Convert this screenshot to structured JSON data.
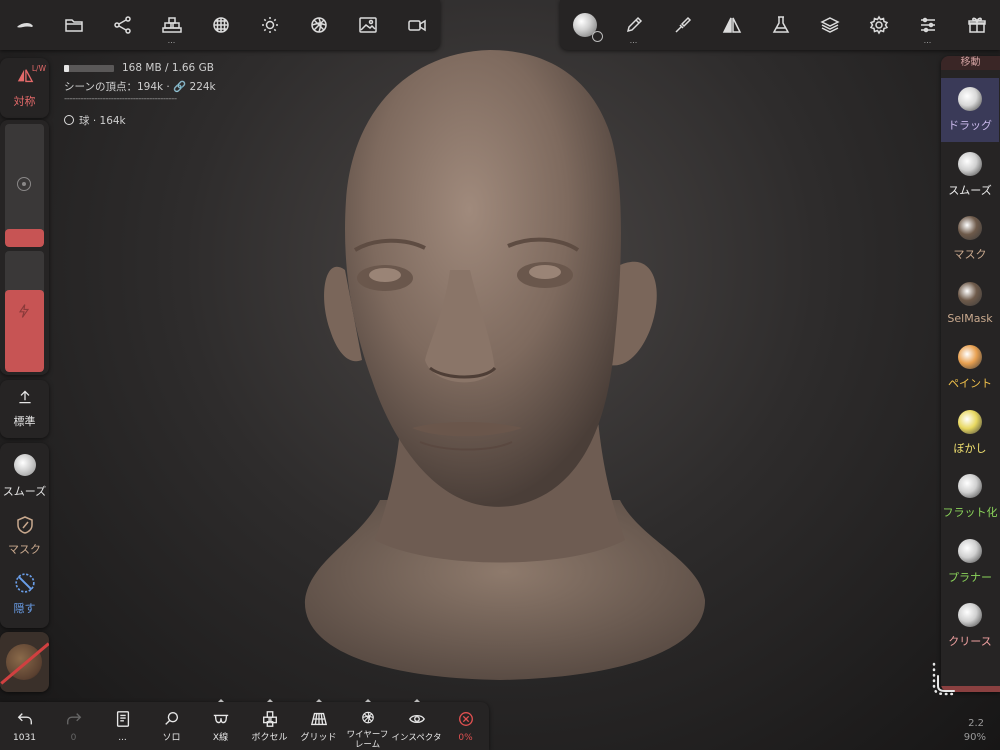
{
  "top_left_toolbar": {
    "buttons": [
      {
        "name": "logo-icon"
      },
      {
        "name": "folder-icon"
      },
      {
        "name": "scene-graph-icon"
      },
      {
        "name": "primitives-icon",
        "more": "..."
      },
      {
        "name": "remesh-icon"
      },
      {
        "name": "light-icon"
      },
      {
        "name": "material-icon"
      },
      {
        "name": "image-icon"
      },
      {
        "name": "video-icon"
      }
    ]
  },
  "top_right_toolbar": {
    "buttons": [
      {
        "name": "brush-preview-icon"
      },
      {
        "name": "pencil-icon",
        "more": "..."
      },
      {
        "name": "paint-brush-icon"
      },
      {
        "name": "symmetry-triangle-icon"
      },
      {
        "name": "flask-icon"
      },
      {
        "name": "layers-icon"
      },
      {
        "name": "gear-icon"
      },
      {
        "name": "sliders-icon",
        "more": "..."
      },
      {
        "name": "gift-icon"
      }
    ]
  },
  "stats": {
    "memory": "168 MB / 1.66 GB",
    "memory_fraction": 0.1,
    "vertices": "シーンの頂点：194k · 🔗 224k",
    "separator": "-----------------------------------------",
    "object": "球 · 164k"
  },
  "left_panel": {
    "symmetry_label": "対称",
    "symmetry_badge": "L/W",
    "radius_fraction": 0.15,
    "intensity_fraction": 0.68,
    "standard_label": "標準",
    "smooth_label": "スムーズ",
    "mask_label": "マスク",
    "hide_label": "隠す"
  },
  "right_panel": {
    "header": "移動",
    "tools": [
      {
        "name": "ドラッグ",
        "color": "#c9b8ea",
        "icon": "#d8d8d8",
        "selected": true
      },
      {
        "name": "スムーズ",
        "color": "#f0f0f0",
        "icon": "#d0d0d0"
      },
      {
        "name": "マスク",
        "color": "#c9a98e",
        "icon": "#6e5a4a"
      },
      {
        "name": "SelMask",
        "color": "#c9a98e",
        "icon": "#6e5a4a"
      },
      {
        "name": "ペイント",
        "color": "#f0c04a",
        "icon": "#e8a050"
      },
      {
        "name": "ぼかし",
        "color": "#f0e070",
        "icon": "#e8d860"
      },
      {
        "name": "フラット化",
        "color": "#8bd45a",
        "icon": "#d0d0d0"
      },
      {
        "name": "プラナー",
        "color": "#8bd45a",
        "icon": "#d0d0d0"
      },
      {
        "name": "クリース",
        "color": "#f0a0a0",
        "icon": "#d0d0d0"
      }
    ]
  },
  "bottom_toolbar": {
    "buttons": [
      {
        "name": "undo-button",
        "label": "1031"
      },
      {
        "name": "redo-button",
        "label": "0"
      },
      {
        "name": "history-button",
        "label": "..."
      },
      {
        "name": "solo-button",
        "label": "ソロ"
      },
      {
        "name": "xray-button",
        "label": "X線"
      },
      {
        "name": "voxel-button",
        "label": "ボクセル"
      },
      {
        "name": "grid-button",
        "label": "グリッド"
      },
      {
        "name": "wireframe-button",
        "label": "ワイヤーフレーム"
      },
      {
        "name": "inspector-button",
        "label": "インスペクタ"
      },
      {
        "name": "cancel-button",
        "label": "0%"
      }
    ]
  },
  "corner": {
    "version": "2.2",
    "zoom": "90%"
  }
}
